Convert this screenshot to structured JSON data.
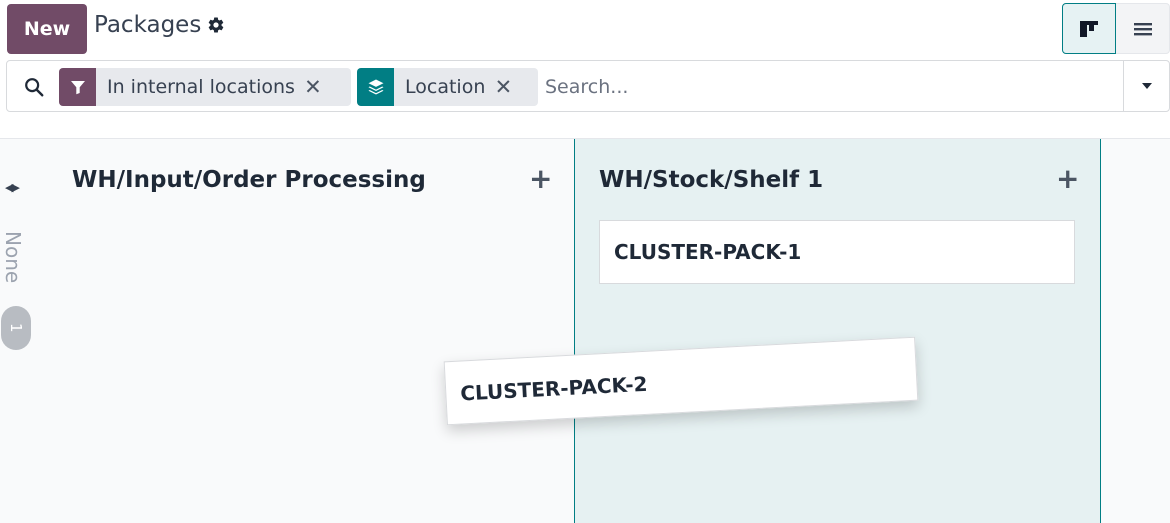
{
  "header": {
    "new_button": "New",
    "title": "Packages",
    "settings_icon": "gear-icon",
    "views": [
      {
        "name": "kanban",
        "icon": "kanban-icon",
        "active": true
      },
      {
        "name": "list",
        "icon": "list-icon",
        "active": false
      }
    ]
  },
  "search": {
    "icon": "search-icon",
    "facets": [
      {
        "icon": "filter-icon",
        "label": "In internal locations",
        "color": "#714b67"
      },
      {
        "icon": "layers-icon",
        "label": "Location",
        "color": "#017e84"
      }
    ],
    "placeholder": "Search...",
    "value": "",
    "toggle_icon": "caret-down-icon"
  },
  "kanban": {
    "folded_column": {
      "title": "None",
      "count": "1",
      "icon": "fold-arrows-icon"
    },
    "columns": [
      {
        "title": "WH/Input/Order Processing",
        "add_icon": "plus-icon",
        "cards": []
      },
      {
        "title": "WH/Stock/Shelf 1",
        "add_icon": "plus-icon",
        "highlighted": true,
        "cards": [
          {
            "title": "CLUSTER-PACK-1"
          }
        ]
      }
    ],
    "dragged_card": {
      "title": "CLUSTER-PACK-2"
    }
  },
  "colors": {
    "primary": "#714b67",
    "accent": "#017e84",
    "drop_zone": "#e6f1f2"
  }
}
